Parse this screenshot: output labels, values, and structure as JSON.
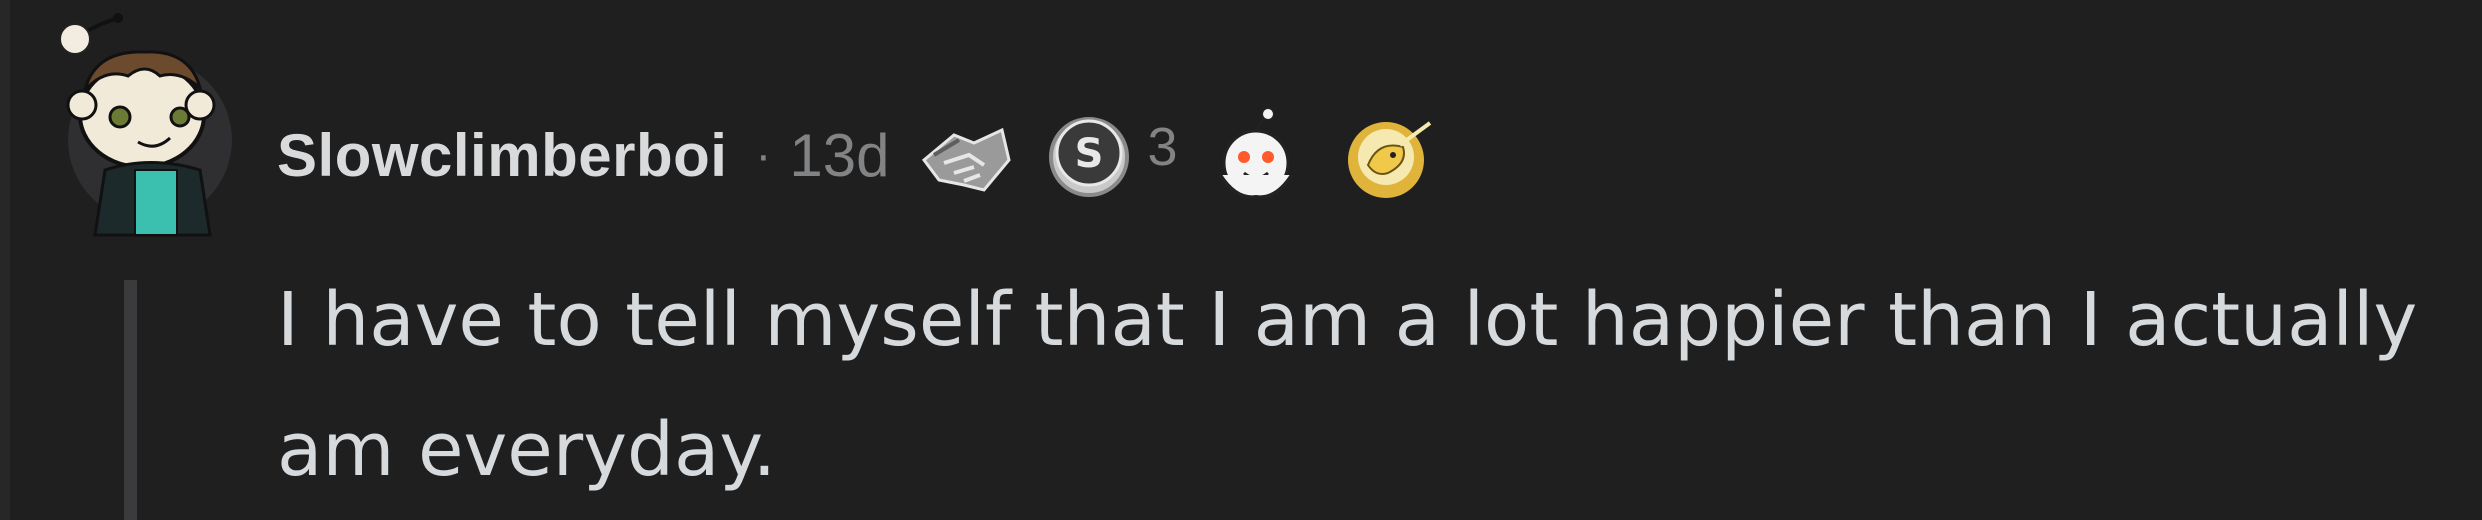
{
  "comment": {
    "username": "Slowclimberboi",
    "separator": "·",
    "age": "13d",
    "awards": [
      {
        "icon": "handshake-award-icon"
      },
      {
        "icon": "silver-award-icon",
        "count": "3"
      },
      {
        "icon": "wholesome-snoo-award-icon"
      },
      {
        "icon": "narwhal-award-icon"
      }
    ],
    "body": "I have to tell myself that I am a lot happier than I actually am everyday."
  },
  "colors": {
    "background": "#1f1f20",
    "text": "#d7dadc",
    "meta": "#818384",
    "thread_line": "#3b3b3d"
  }
}
